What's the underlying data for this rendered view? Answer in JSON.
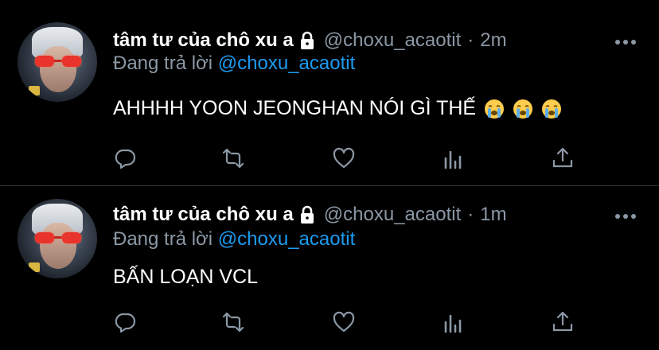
{
  "tweets": [
    {
      "display_name": "tâm tư của chô xu a",
      "handle": "@choxu_acaotit",
      "separator": "·",
      "time": "2m",
      "reply_prefix": "Đang trả lời",
      "reply_to": "@choxu_acaotit",
      "text": "AHHHH YOON JEONGHAN NÓI GÌ THẾ",
      "emojis": [
        "loudly-crying-face",
        "loudly-crying-face",
        "loudly-crying-face"
      ]
    },
    {
      "display_name": "tâm tư của chô xu a",
      "handle": "@choxu_acaotit",
      "separator": "·",
      "time": "1m",
      "reply_prefix": "Đang trả lời",
      "reply_to": "@choxu_acaotit",
      "text": "BẤN LOẠN VCL",
      "emojis": []
    }
  ],
  "icons": [
    "lock-icon",
    "more-icon",
    "reply-icon",
    "retweet-icon",
    "like-icon",
    "analytics-icon",
    "share-icon"
  ],
  "colors": {
    "background": "#000000",
    "text_primary": "#ffffff",
    "text_secondary": "#8b98a5",
    "accent": "#1d9bf0",
    "divider": "#2f3336"
  }
}
